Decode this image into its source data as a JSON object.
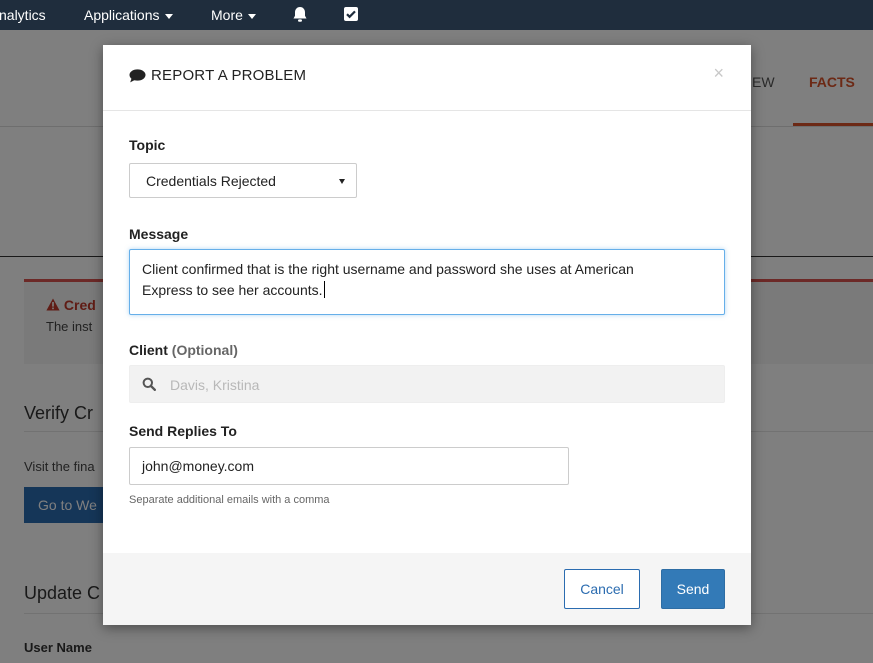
{
  "navbar": {
    "items": [
      {
        "label": "nalytics"
      },
      {
        "label": "Applications"
      },
      {
        "label": "More"
      }
    ]
  },
  "background": {
    "tabs": [
      "EW",
      "FACTS"
    ],
    "alert": {
      "title": "Cred",
      "text": "The inst"
    },
    "sections": [
      {
        "heading": "Verify Cr",
        "text": "Visit the fina",
        "button": "Go to We"
      },
      {
        "heading": "Update C"
      }
    ],
    "field_label": "User Name"
  },
  "modal": {
    "title": "REPORT A PROBLEM",
    "close": "×",
    "topic": {
      "label": "Topic",
      "selected": "Credentials Rejected"
    },
    "message": {
      "label": "Message",
      "line1": "Client confirmed that is the right username and password she uses at American",
      "line2": "Express to see her accounts."
    },
    "client": {
      "label": "Client",
      "optional": "(Optional)",
      "value": "Davis, Kristina"
    },
    "replies": {
      "label": "Send Replies To",
      "value": "john@money.com",
      "help": "Separate additional emails with a comma"
    },
    "buttons": {
      "cancel": "Cancel",
      "send": "Send"
    }
  },
  "colors": {
    "navbar": "#1f2d3d",
    "accent": "#d9532b",
    "primary": "#337ab7",
    "alert_border": "#d9534f"
  },
  "icons": {
    "notifications": "bell-icon",
    "tasks": "checkbox-icon",
    "title": "comment-icon",
    "client_search": "search-icon"
  }
}
